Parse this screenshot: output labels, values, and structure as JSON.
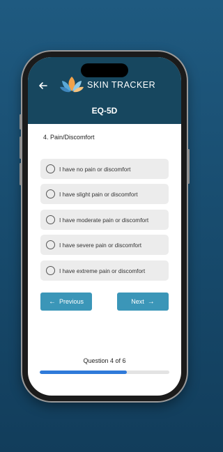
{
  "header": {
    "brand": "SKIN TRACKER",
    "section_title": "EQ-5D"
  },
  "question": {
    "title": "4. Pain/Discomfort",
    "options": [
      "I have no pain or discomfort",
      "I have slight pain or discomfort",
      "I have moderate pain or discomfort",
      "I have severe pain or discomfort",
      "I have extreme pain or discomfort"
    ]
  },
  "navigation": {
    "previous_label": "Previous",
    "next_label": "Next"
  },
  "progress": {
    "label": "Question 4 of 6",
    "fraction": 0.67
  },
  "colors": {
    "header": "#17475f",
    "button": "#3b96b8",
    "progress": "#2f7ad9"
  }
}
